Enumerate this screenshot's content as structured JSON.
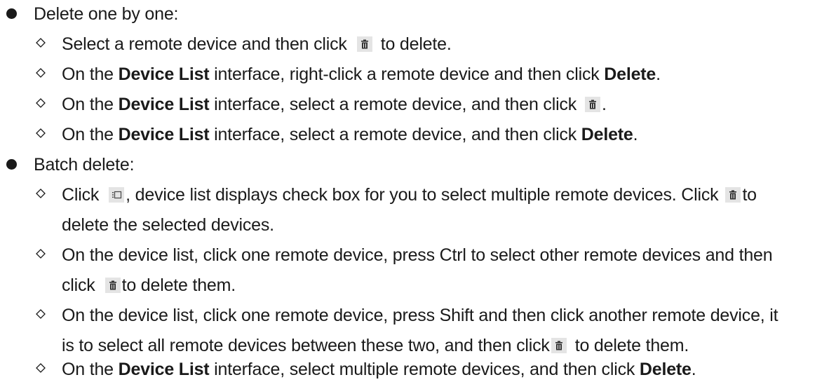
{
  "items": [
    {
      "level": 1,
      "parts": [
        "Delete one by one:"
      ]
    },
    {
      "level": 2,
      "parts": [
        "Select a remote device and then click",
        "ICON_TRASH",
        "to delete."
      ]
    },
    {
      "level": 2,
      "parts": [
        "On the ",
        "**Device List**",
        " interface, right-click a remote device and then click ",
        "**Delete**",
        "."
      ]
    },
    {
      "level": 2,
      "parts": [
        "On the ",
        "**Device List**",
        " interface, select a remote device, and then click",
        "ICON_TRASH",
        "."
      ]
    },
    {
      "level": 2,
      "parts": [
        "On the ",
        "**Device List**",
        " interface, select a remote device, and then click ",
        "**Delete**",
        "."
      ]
    },
    {
      "level": 1,
      "parts": [
        "Batch delete:"
      ]
    },
    {
      "level": 2,
      "parts": [
        "Click",
        "ICON_MULTI",
        ", device list displays check box for you to select multiple remote devices. Click",
        "ICON_TRASH",
        "to"
      ]
    },
    {
      "level": 3,
      "parts": [
        "delete the selected devices."
      ]
    },
    {
      "level": 2,
      "parts": [
        "On the device list, click one remote device, press Ctrl to select other remote devices and then"
      ]
    },
    {
      "level": 3,
      "parts": [
        "click",
        "ICON_TRASH",
        "to delete them."
      ]
    },
    {
      "level": 2,
      "parts": [
        "On the device list, click one remote device, press Shift and then click another remote device, it"
      ]
    },
    {
      "level": 3,
      "parts": [
        "is to select all remote devices between these two, and then click",
        "ICON_TRASH",
        "to delete them."
      ]
    },
    {
      "level": 2,
      "parts": [
        "On the ",
        "**Device List**",
        " interface, select multiple remote devices, and then click ",
        "**Delete**",
        "."
      ]
    }
  ],
  "icons": {
    "trash": "trash-icon",
    "multi": "multi-select-icon"
  }
}
